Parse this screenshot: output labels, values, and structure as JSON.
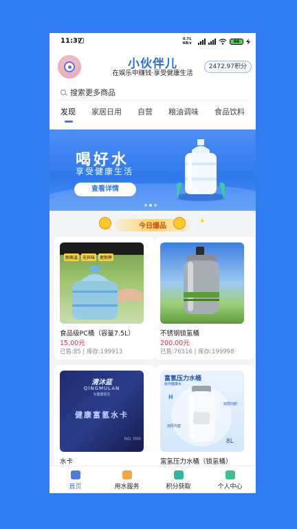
{
  "status_bar": {
    "time": "11:37",
    "net_speed": "0.71 KB/s",
    "battery": "66"
  },
  "header": {
    "title": "小伙伴儿",
    "subtitle": "在娱乐中赚钱·享受健康生活",
    "points": "2472.97积分"
  },
  "search": {
    "placeholder": "搜索更多商品"
  },
  "tabs": [
    {
      "label": "发现",
      "active": true
    },
    {
      "label": "家居日用"
    },
    {
      "label": "自营"
    },
    {
      "label": "粮油调味"
    },
    {
      "label": "食品饮料"
    }
  ],
  "banner": {
    "headline": "喝好水",
    "tagline": "享受健康生活",
    "button": "查看详情",
    "active_slide": 2,
    "slide_count": 3
  },
  "hot_today": {
    "label": "今日爆品"
  },
  "products": [
    {
      "name": "食品级PC桶（容量7.5L）",
      "price": "15.00元",
      "meta": "已售:85 | 库存:199913",
      "tags": [
        "耐高温",
        "无异味",
        "更耐摔"
      ]
    },
    {
      "name": "不锈钢锁氢桶",
      "price": "200.00元",
      "meta": "已售:76516 | 库存:199998"
    },
    {
      "name": "水卡",
      "card_brand": "清沐蓝",
      "card_brand_en": "QINGMULAN",
      "card_slogan": "为健康而生",
      "card_title": "健康富氢水卡",
      "card_no": "NO. 000"
    },
    {
      "name": "富氢压力水桶（锁氢桶）",
      "image_title": "富氢压力水桶",
      "image_sub": "给你健康水",
      "label_h": "H",
      "label_a": "双层内胆",
      "label_b": "加厚内壁",
      "volume": "8L"
    }
  ],
  "bottom_nav": [
    {
      "label": "首页",
      "icon": "home-icon",
      "active": true
    },
    {
      "label": "用水服务",
      "icon": "wallet-icon"
    },
    {
      "label": "积分获取",
      "icon": "task-icon"
    },
    {
      "label": "个人中心",
      "icon": "profile-icon"
    }
  ],
  "colors": {
    "primary": "#2F7DF0",
    "price": "#D0324B",
    "banner_dark": "#2F78EE"
  }
}
